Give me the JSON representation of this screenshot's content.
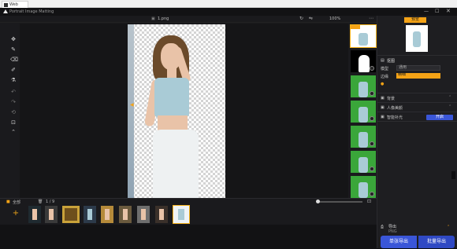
{
  "browser": {
    "tab_title": "Web"
  },
  "app": {
    "title": "Portrait Image Matting",
    "file_name": "1.png",
    "zoom": "100%",
    "window_controls": [
      "minimize-icon",
      "maximize-icon",
      "close-icon"
    ]
  },
  "left_tools": [
    "move-icon",
    "brush-icon",
    "eraser-icon",
    "repair-brush-icon",
    "bucket-icon",
    "undo-icon",
    "redo-icon",
    "reset-icon",
    "crop-icon",
    "collapse-icon"
  ],
  "right_panel": {
    "preview_button": "预览",
    "section_title": "抠图",
    "row1_label": "模型",
    "row1_value": "通用",
    "row2_label": "边缘",
    "row2_value": "精细",
    "rows": [
      "背景",
      "人像美颜",
      "智能补光"
    ],
    "blue_button": "开启",
    "export_label": "导出",
    "export_subtext": "PNG",
    "single_export": "单张导出",
    "batch_export": "批量导出"
  },
  "film_toolbar": {
    "label_all": "全部",
    "label_count": "1 / 9"
  },
  "colors": {
    "accent": "#f5a316",
    "primary_blue": "#3a56d8",
    "select_outline": "#f5b21a",
    "background": "#1a1a1d"
  }
}
